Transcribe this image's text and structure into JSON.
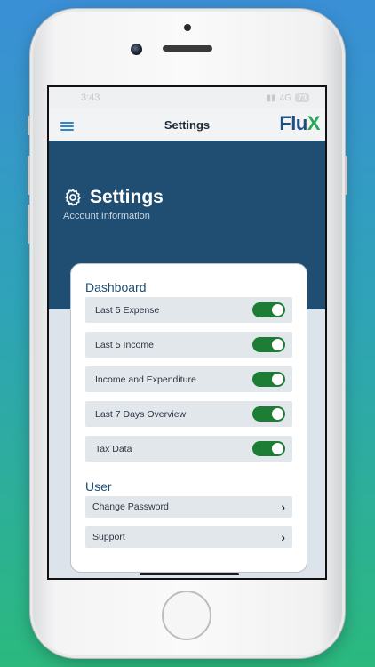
{
  "status": {
    "time": "3:43",
    "network": "4G",
    "battery": "73"
  },
  "nav": {
    "title": "Settings",
    "logo_main": "Flu",
    "logo_accent": "X"
  },
  "hero": {
    "title": "Settings",
    "subtitle": "Account Information"
  },
  "dashboard": {
    "title": "Dashboard",
    "items": [
      {
        "label": "Last 5 Expense",
        "on": true
      },
      {
        "label": "Last 5 Income",
        "on": true
      },
      {
        "label": "Income and Expenditure",
        "on": true
      },
      {
        "label": "Last 7 Days Overview",
        "on": true
      },
      {
        "label": "Tax Data",
        "on": true
      }
    ]
  },
  "user": {
    "title": "User",
    "items": [
      {
        "label": "Change Password"
      },
      {
        "label": "Support"
      }
    ]
  },
  "colors": {
    "accent": "#1f4e72",
    "toggle_on": "#1e7d35",
    "menu": "#2f86c9"
  }
}
